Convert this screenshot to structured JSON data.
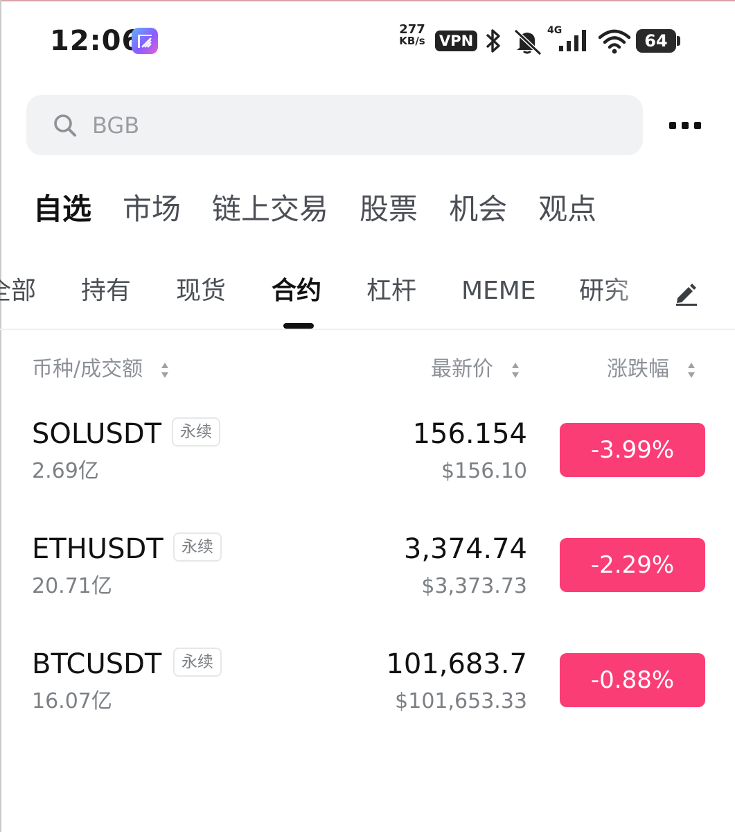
{
  "status_bar": {
    "time": "12:06",
    "net_speed_value": "277",
    "net_speed_unit": "KB/s",
    "vpn_label": "VPN",
    "network_type": "4G",
    "battery": "64"
  },
  "search": {
    "placeholder": "BGB"
  },
  "main_tabs": [
    "自选",
    "市场",
    "链上交易",
    "股票",
    "机会",
    "观点"
  ],
  "sub_tabs": [
    "全部",
    "持有",
    "现货",
    "合约",
    "杠杆",
    "MEME",
    "研究"
  ],
  "columns": {
    "pair_volume": "币种/成交额",
    "last_price": "最新价",
    "change": "涨跌幅"
  },
  "rows": [
    {
      "symbol": "SOLUSDT",
      "tag": "永续",
      "volume": "2.69亿",
      "price": "156.154",
      "fiat_price": "$156.10",
      "change": "-3.99%"
    },
    {
      "symbol": "ETHUSDT",
      "tag": "永续",
      "volume": "20.71亿",
      "price": "3,374.74",
      "fiat_price": "$3,373.73",
      "change": "-2.29%"
    },
    {
      "symbol": "BTCUSDT",
      "tag": "永续",
      "volume": "16.07亿",
      "price": "101,683.7",
      "fiat_price": "$101,653.33",
      "change": "-0.88%"
    }
  ],
  "colors": {
    "negative": "#fb3d76",
    "text_primary": "#111111",
    "text_secondary": "#7c8085"
  }
}
